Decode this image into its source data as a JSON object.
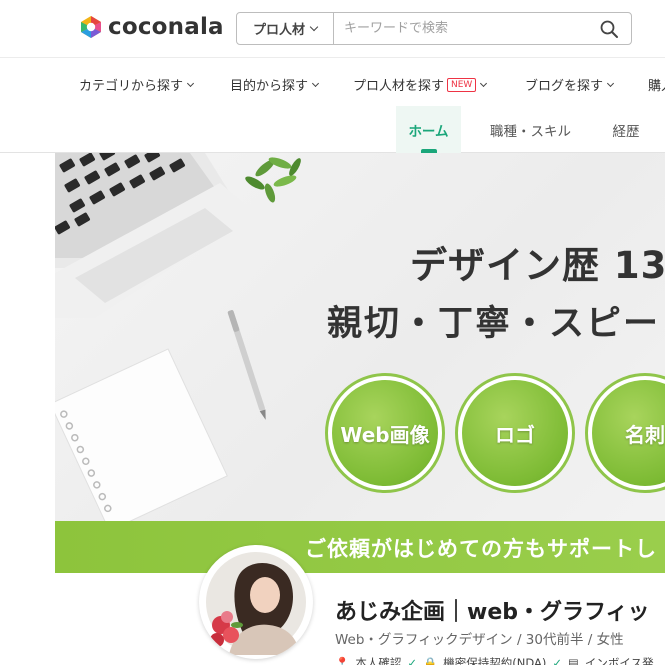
{
  "logo": {
    "text": "coconala"
  },
  "search": {
    "category": "プロ人材",
    "placeholder": "キーワードで検索"
  },
  "nav": {
    "items": [
      {
        "label": "カテゴリから探す"
      },
      {
        "label": "目的から探す"
      },
      {
        "label": "プロ人材を探す",
        "badge": "NEW"
      },
      {
        "label": "ブログを探す"
      },
      {
        "label": "購入"
      }
    ]
  },
  "tabs": [
    {
      "label": "ホーム",
      "active": true
    },
    {
      "label": "職種・スキル"
    },
    {
      "label": "経歴"
    }
  ],
  "banner": {
    "title": "デザイン歴 13",
    "subtitle": "親切・丁寧・スピー",
    "circles": [
      "Web画像",
      "ロゴ",
      "名刺"
    ],
    "strip": "ご依頼がはじめての方もサポートし"
  },
  "profile": {
    "name": "あじみ企画｜web・グラフィッ",
    "meta": "Web・グラフィックデザイン / 30代前半 / 女性",
    "badges": [
      "本人確認",
      "機密保持契約(NDA)",
      "インボイス発"
    ]
  },
  "colors": {
    "accent": "#1aa67a",
    "banner_green": "#8dc43c",
    "new_badge": "#e33344"
  }
}
